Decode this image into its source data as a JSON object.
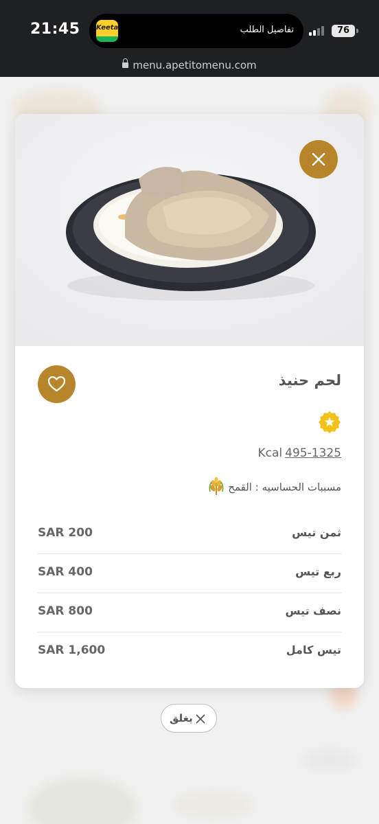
{
  "status_bar": {
    "time": "21:45",
    "app_name": "Keeta",
    "activity_title": "تفاصيل الطلب",
    "battery": "76"
  },
  "browser": {
    "url": "menu.apetitomenu.com"
  },
  "dish": {
    "name": "لحم حنيذ",
    "kcal_unit": "Kcal",
    "kcal_range": "495-1325",
    "allergens": "مسببات الحساسيه : القمح"
  },
  "prices": [
    {
      "label": "ثمن تيس",
      "amount": "SAR 200"
    },
    {
      "label": "ربع تيس",
      "amount": "SAR 400"
    },
    {
      "label": "نصف تيس",
      "amount": "SAR 800"
    },
    {
      "label": "تيس كامل",
      "amount": "SAR 1,600"
    }
  ],
  "close_label": "يغلق",
  "colors": {
    "accent": "#b8862a",
    "badge": "#f2c21b"
  },
  "icons": [
    "close-icon",
    "heart-icon",
    "star-icon",
    "wheat-icon",
    "lock-icon",
    "signal-icon",
    "battery-icon"
  ]
}
